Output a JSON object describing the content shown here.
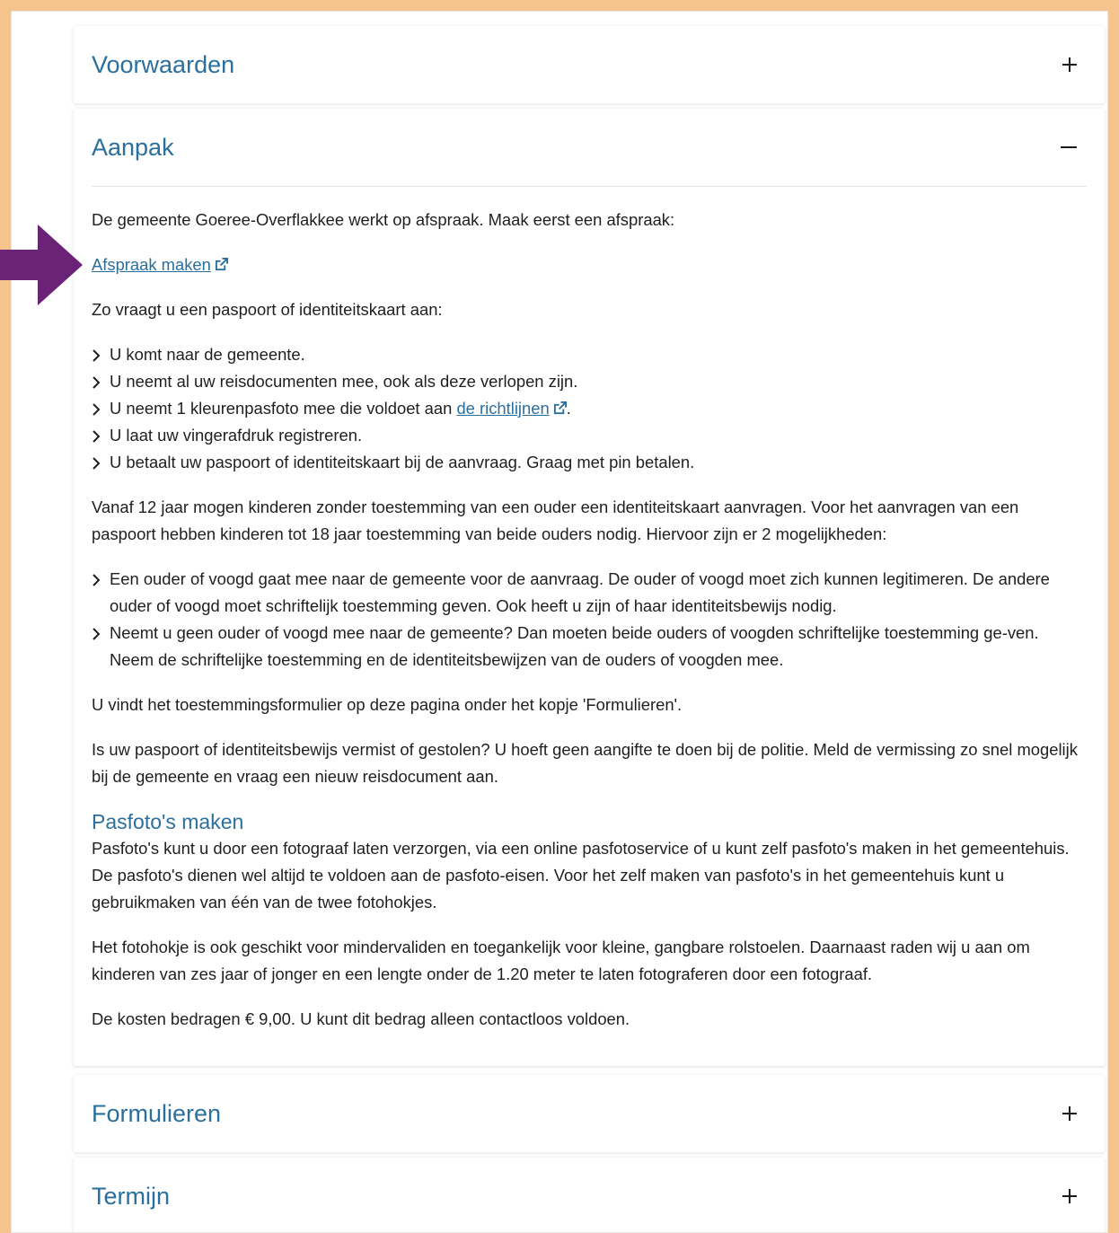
{
  "sections": {
    "voorwaarden": {
      "title": "Voorwaarden",
      "toggle": "+"
    },
    "aanpak": {
      "title": "Aanpak",
      "toggle": "−",
      "intro": "De gemeente Goeree-Overflakkee werkt op afspraak. Maak eerst een afspraak:",
      "appointment_link": "Afspraak maken",
      "how_to": "Zo vraagt u een paspoort of identiteitskaart aan:",
      "steps": [
        {
          "text": "U komt naar de gemeente."
        },
        {
          "text": "U neemt al uw reisdocumenten mee, ook als deze verlopen zijn."
        },
        {
          "text": "U neemt 1 kleurenpasfoto mee die voldoet aan ",
          "link": "de richtlijnen",
          "after": "."
        },
        {
          "text": "U laat uw vingerafdruk registreren."
        },
        {
          "text": "U betaalt uw paspoort of identiteitskaart bij de aanvraag. Graag met pin betalen."
        }
      ],
      "children_text": "Vanaf 12 jaar mogen kinderen zonder toestemming van een ouder een identiteitskaart aanvragen. Voor het aanvragen van een paspoort hebben kinderen tot 18 jaar toestemming van beide ouders nodig. Hiervoor zijn er 2 mogelijkheden:",
      "options": [
        "Een ouder of voogd gaat mee naar de gemeente voor de aanvraag. De ouder of voogd moet zich kunnen legitimeren. De andere ouder of voogd moet schriftelijk toestemming geven. Ook heeft u zijn of haar identiteitsbewijs nodig.",
        "Neemt u geen ouder of voogd mee naar de gemeente? Dan moeten beide ouders of voogden schriftelijke toestemming ge-ven. Neem de schriftelijke toestemming en de identiteitsbewijzen van de ouders of voogden mee."
      ],
      "form_text": "U vindt het toestemmingsformulier op deze pagina onder het kopje 'Formulieren'.",
      "lost_text": "Is uw paspoort of identiteitsbewijs vermist of gestolen? U hoeft geen aangifte te doen bij de politie. Meld de vermissing zo snel mogelijk bij de gemeente en vraag een nieuw reisdocument aan.",
      "photo_heading": "Pasfoto's maken",
      "photo_text": "Pasfoto's kunt u door een fotograaf laten verzorgen, via een online pasfotoservice of u kunt zelf pasfoto's maken in het gemeentehuis. De pasfoto's dienen wel altijd te voldoen aan de pasfoto-eisen. Voor het zelf maken van pasfoto's in het gemeentehuis kunt u gebruikmaken van één van de twee fotohokjes.",
      "booth_text": "Het fotohokje is ook geschikt voor mindervaliden en toegankelijk voor kleine, gangbare rolstoelen. Daarnaast raden wij u aan om kinderen van zes jaar of jonger en een lengte onder de 1.20 meter te laten fotograferen door een fotograaf.",
      "cost_text": "De kosten bedragen € 9,00. U kunt dit bedrag alleen contactloos voldoen."
    },
    "formulieren": {
      "title": "Formulieren",
      "toggle": "+"
    },
    "termijn": {
      "title": "Termijn",
      "toggle": "+"
    }
  },
  "colors": {
    "accent": "#2b6f9e",
    "frame": "#f4c48c",
    "arrow": "#6b2378"
  },
  "icons": {
    "external": "external-link-icon",
    "chevron": "chevron-right-icon",
    "pointer": "arrow-right-icon"
  }
}
